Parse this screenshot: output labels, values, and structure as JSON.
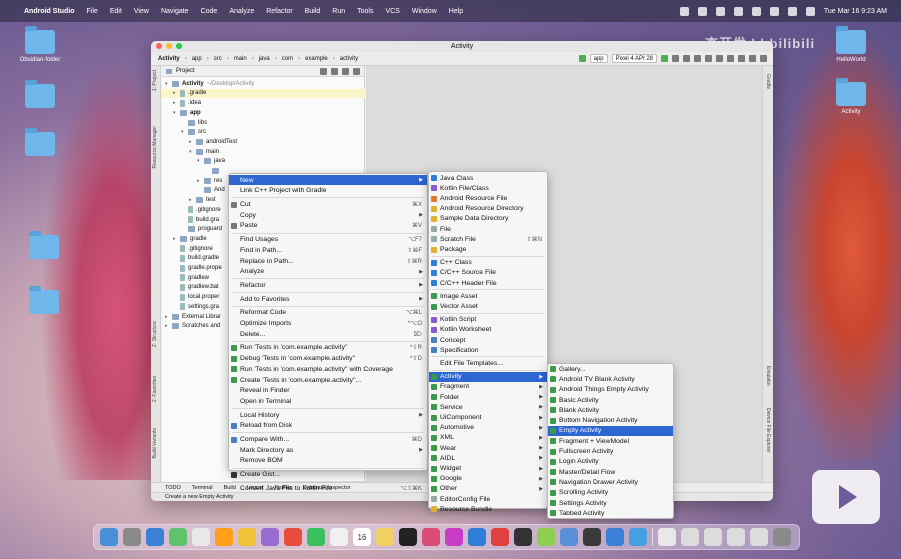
{
  "menubar": {
    "app": "Android Studio",
    "items": [
      "File",
      "Edit",
      "View",
      "Navigate",
      "Code",
      "Analyze",
      "Refactor",
      "Build",
      "Run",
      "Tools",
      "VCS",
      "Window",
      "Help"
    ],
    "clock": "Tue Mar 16  9:23 AM"
  },
  "desktop": {
    "left_icons": [
      "Obsidian-folder",
      "",
      "",
      "",
      ""
    ],
    "right_icons": [
      "HelloWorld",
      "Activity"
    ]
  },
  "ide": {
    "title": "Activity",
    "breadcrumbs": [
      "Activity",
      "app",
      "src",
      "main",
      "java",
      "com",
      "example",
      "activity"
    ],
    "run_config": "app",
    "device": "Pixel 4 API 28",
    "project_panel_title": "Project",
    "tree": [
      {
        "label": "Activity",
        "note": "~/Desktop/Activity",
        "indent": 0,
        "arrow": "▾",
        "bold": true
      },
      {
        "label": ".gradle",
        "note": "",
        "indent": 1,
        "arrow": "▸",
        "hl": true
      },
      {
        "label": ".idea",
        "note": "",
        "indent": 1,
        "arrow": "▸"
      },
      {
        "label": "app",
        "note": "",
        "indent": 1,
        "arrow": "▾",
        "bold": true
      },
      {
        "label": "libs",
        "note": "",
        "indent": 2,
        "arrow": ""
      },
      {
        "label": "src",
        "note": "",
        "indent": 2,
        "arrow": "▾"
      },
      {
        "label": "androidTest",
        "note": "",
        "indent": 3,
        "arrow": "▸"
      },
      {
        "label": "main",
        "note": "",
        "indent": 3,
        "arrow": "▾"
      },
      {
        "label": "java",
        "note": "",
        "indent": 4,
        "arrow": "▾"
      },
      {
        "label": "",
        "note": "",
        "indent": 5,
        "arrow": "",
        "sel": true
      },
      {
        "label": "res",
        "note": "",
        "indent": 4,
        "arrow": "▸"
      },
      {
        "label": "And",
        "note": "",
        "indent": 4,
        "arrow": ""
      },
      {
        "label": "test",
        "note": "",
        "indent": 3,
        "arrow": "▸"
      },
      {
        "label": ".gitignore",
        "note": "",
        "indent": 2,
        "arrow": ""
      },
      {
        "label": "build.gra",
        "note": "",
        "indent": 2,
        "arrow": ""
      },
      {
        "label": "proguard",
        "note": "",
        "indent": 2,
        "arrow": ""
      },
      {
        "label": "gradle",
        "note": "",
        "indent": 1,
        "arrow": "▸"
      },
      {
        "label": ".gitignore",
        "note": "",
        "indent": 1,
        "arrow": ""
      },
      {
        "label": "build.gradle",
        "note": "",
        "indent": 1,
        "arrow": ""
      },
      {
        "label": "gradle.prope",
        "note": "",
        "indent": 1,
        "arrow": ""
      },
      {
        "label": "gradlew",
        "note": "",
        "indent": 1,
        "arrow": ""
      },
      {
        "label": "gradlew.bat",
        "note": "",
        "indent": 1,
        "arrow": ""
      },
      {
        "label": "local.proper",
        "note": "",
        "indent": 1,
        "arrow": ""
      },
      {
        "label": "settings.gra",
        "note": "",
        "indent": 1,
        "arrow": ""
      },
      {
        "label": "External Librar",
        "note": "",
        "indent": 0,
        "arrow": "▸"
      },
      {
        "label": "Scratches and",
        "note": "",
        "indent": 0,
        "arrow": "▸"
      }
    ],
    "left_tabs": [
      "1: Project",
      "Resource Manager",
      "Z: Structure",
      "2: Favorites",
      "Build Variants"
    ],
    "right_tabs": [
      "Gradle",
      "Emulator",
      "Device File Explorer"
    ],
    "bottom_tabs": [
      "TODO",
      "Terminal",
      "Build",
      "Logcat",
      "Profiler",
      "Database Inspector",
      "Event Log",
      "Layout Inspector"
    ],
    "status": "Create a new Empty Activity"
  },
  "context_menu": [
    {
      "label": "New",
      "sc": "",
      "sub": true,
      "sel": true
    },
    {
      "label": "Link C++ Project with Gradle",
      "sc": ""
    },
    {
      "sep": true
    },
    {
      "label": "Cut",
      "sc": "⌘X",
      "icon": "#777"
    },
    {
      "label": "Copy",
      "sc": "",
      "sub": true
    },
    {
      "label": "Paste",
      "sc": "⌘V",
      "icon": "#777"
    },
    {
      "sep": true
    },
    {
      "label": "Find Usages",
      "sc": "⌥F7"
    },
    {
      "label": "Find in Path...",
      "sc": "⇧⌘F"
    },
    {
      "label": "Replace in Path...",
      "sc": "⇧⌘R"
    },
    {
      "label": "Analyze",
      "sc": "",
      "sub": true
    },
    {
      "sep": true
    },
    {
      "label": "Refactor",
      "sc": "",
      "sub": true
    },
    {
      "sep": true
    },
    {
      "label": "Add to Favorites",
      "sc": "",
      "sub": true
    },
    {
      "sep": true
    },
    {
      "label": "Reformat Code",
      "sc": "⌥⌘L"
    },
    {
      "label": "Optimize Imports",
      "sc": "^⌥O"
    },
    {
      "label": "Delete...",
      "sc": "⌦"
    },
    {
      "sep": true
    },
    {
      "label": "Run 'Tests in 'com.example.activity''",
      "sc": "^⇧R",
      "icon": "#3c9a4a"
    },
    {
      "label": "Debug 'Tests in 'com.example.activity''",
      "sc": "^⇧D",
      "icon": "#3c9a4a"
    },
    {
      "label": "Run 'Tests in 'com.example.activity'' with Coverage",
      "sc": "",
      "icon": "#3c9a4a"
    },
    {
      "label": "Create 'Tests in 'com.example.activity''...",
      "sc": "",
      "icon": "#3c9a4a"
    },
    {
      "label": "Reveal in Finder",
      "sc": ""
    },
    {
      "label": "Open in Terminal",
      "sc": ""
    },
    {
      "sep": true
    },
    {
      "label": "Local History",
      "sc": "",
      "sub": true
    },
    {
      "label": "Reload from Disk",
      "sc": "",
      "icon": "#4a7fc1"
    },
    {
      "sep": true
    },
    {
      "label": "Compare With...",
      "sc": "⌘D",
      "icon": "#4a7fc1"
    },
    {
      "label": "Mark Directory as",
      "sc": "",
      "sub": true
    },
    {
      "label": "Remove BOM",
      "sc": ""
    },
    {
      "sep": true
    },
    {
      "label": "Create Gist...",
      "sc": "",
      "icon": "#333"
    },
    {
      "sep": true
    },
    {
      "label": "Convert Java File to Kotlin File",
      "sc": "⌥⇧⌘K"
    }
  ],
  "new_menu": [
    {
      "label": "Java Class",
      "icon": "#2f7fd8"
    },
    {
      "label": "Kotlin File/Class",
      "icon": "#8a5ad1"
    },
    {
      "label": "Android Resource File",
      "icon": "#e07a2f"
    },
    {
      "label": "Android Resource Directory",
      "icon": "#e0b02f"
    },
    {
      "label": "Sample Data Directory",
      "icon": "#e0b02f"
    },
    {
      "label": "File",
      "icon": "#9aa"
    },
    {
      "label": "Scratch File",
      "sc": "⇧⌘N",
      "icon": "#9aa"
    },
    {
      "label": "Package",
      "icon": "#e0b02f"
    },
    {
      "sep": true
    },
    {
      "label": "C++ Class",
      "icon": "#2f7fd8"
    },
    {
      "label": "C/C++ Source File",
      "icon": "#2f7fd8"
    },
    {
      "label": "C/C++ Header File",
      "icon": "#2f7fd8"
    },
    {
      "sep": true
    },
    {
      "label": "Image Asset",
      "icon": "#3c9a4a"
    },
    {
      "label": "Vector Asset",
      "icon": "#3c9a4a"
    },
    {
      "sep": true
    },
    {
      "label": "Kotlin Script",
      "icon": "#8a5ad1"
    },
    {
      "label": "Kotlin Worksheet",
      "icon": "#8a5ad1"
    },
    {
      "label": "Concept",
      "icon": "#4a7fc1"
    },
    {
      "label": "Specification",
      "icon": "#4a7fc1"
    },
    {
      "sep": true
    },
    {
      "label": "Edit File Templates...",
      "icon": ""
    },
    {
      "sep": true
    },
    {
      "label": "Activity",
      "sub": true,
      "sel": true,
      "icon": "#3c9a4a"
    },
    {
      "label": "Fragment",
      "sub": true,
      "icon": "#3c9a4a"
    },
    {
      "label": "Folder",
      "sub": true,
      "icon": "#3c9a4a"
    },
    {
      "label": "Service",
      "sub": true,
      "icon": "#3c9a4a"
    },
    {
      "label": "UiComponent",
      "sub": true,
      "icon": "#3c9a4a"
    },
    {
      "label": "Automotive",
      "sub": true,
      "icon": "#3c9a4a"
    },
    {
      "label": "XML",
      "sub": true,
      "icon": "#3c9a4a"
    },
    {
      "label": "Wear",
      "sub": true,
      "icon": "#3c9a4a"
    },
    {
      "label": "AIDL",
      "sub": true,
      "icon": "#3c9a4a"
    },
    {
      "label": "Widget",
      "sub": true,
      "icon": "#3c9a4a"
    },
    {
      "label": "Google",
      "sub": true,
      "icon": "#3c9a4a"
    },
    {
      "label": "Other",
      "sub": true,
      "icon": "#3c9a4a"
    },
    {
      "label": "EditorConfig File",
      "icon": "#9aa"
    },
    {
      "label": "Resource Bundle",
      "icon": "#e0b02f"
    }
  ],
  "activity_menu": [
    {
      "label": "Gallery...",
      "icon": "#3c9a4a"
    },
    {
      "label": "Android TV Blank Activity",
      "icon": "#3c9a4a"
    },
    {
      "label": "Android Things Empty Activity",
      "icon": "#3c9a4a"
    },
    {
      "label": "Basic Activity",
      "icon": "#3c9a4a"
    },
    {
      "label": "Blank Activity",
      "icon": "#3c9a4a"
    },
    {
      "label": "Bottom Navigation Activity",
      "icon": "#3c9a4a"
    },
    {
      "label": "Empty Activity",
      "icon": "#3c9a4a",
      "sel": true
    },
    {
      "label": "Fragment + ViewModel",
      "icon": "#3c9a4a"
    },
    {
      "label": "Fullscreen Activity",
      "icon": "#3c9a4a"
    },
    {
      "label": "Login Activity",
      "icon": "#3c9a4a"
    },
    {
      "label": "Master/Detail Flow",
      "icon": "#3c9a4a"
    },
    {
      "label": "Navigation Drawer Activity",
      "icon": "#3c9a4a"
    },
    {
      "label": "Scrolling Activity",
      "icon": "#3c9a4a"
    },
    {
      "label": "Settings Activity",
      "icon": "#3c9a4a"
    },
    {
      "label": "Tabbed Activity",
      "icon": "#3c9a4a"
    }
  ],
  "dock": {
    "calendar_day": "16",
    "colors": [
      "#4a90d9",
      "#8a8a8a",
      "#3b7fd6",
      "#5fc36b",
      "#e8e8e8",
      "#ff9f1a",
      "#f0c23b",
      "#9a6bd1",
      "#e74c3c",
      "#3bc060",
      "#f0f0f0",
      "#b48a5a",
      "#f0d060",
      "#222",
      "#d94c78",
      "#c83cc8",
      "#2f7fd8",
      "#e04040",
      "#333",
      "#8fcf4f",
      "#5a8fd8",
      "#3a3a3a",
      "#3b7fd6",
      "#45a0e0",
      "#e8e8e8",
      "#dcdcdc",
      "#dcdcdc",
      "#dcdcdc",
      "#dcdcdc",
      "#8a8a8a"
    ]
  },
  "watermark": {
    "text": "李开发dd",
    "brand": "bilibili"
  }
}
